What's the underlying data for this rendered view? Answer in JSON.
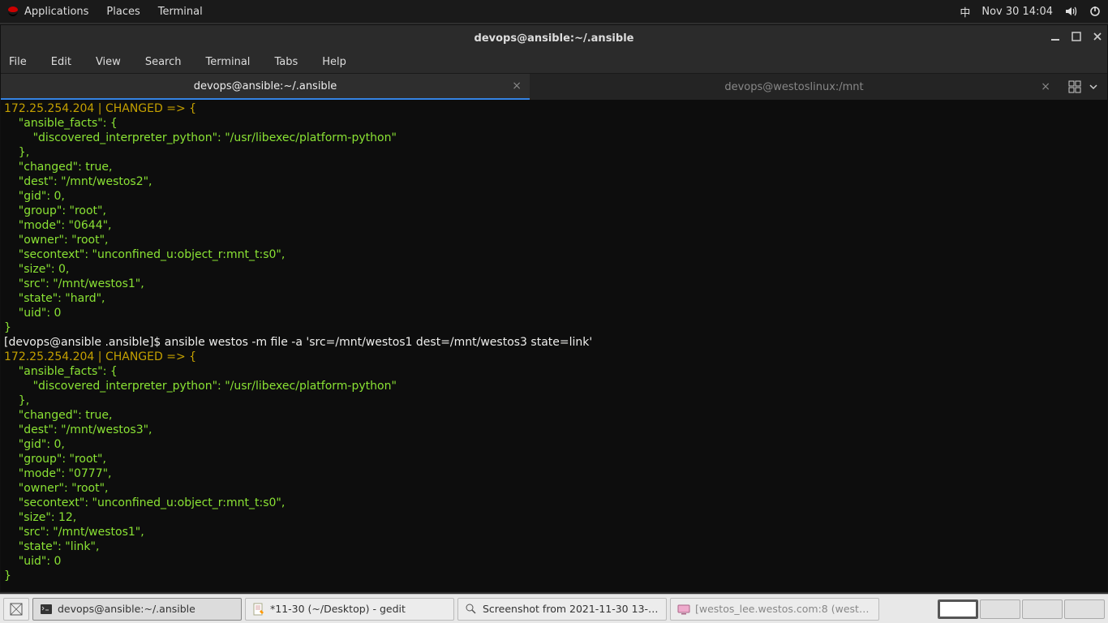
{
  "topbar": {
    "applications": "Applications",
    "places": "Places",
    "terminal": "Terminal",
    "ime": "中",
    "clock": "Nov 30  14:04"
  },
  "window": {
    "title": "devops@ansible:~/.ansible",
    "menu": {
      "file": "File",
      "edit": "Edit",
      "view": "View",
      "search": "Search",
      "terminal": "Terminal",
      "tabs": "Tabs",
      "help": "Help"
    },
    "tabs": [
      {
        "label": "devops@ansible:~/.ansible",
        "active": true
      },
      {
        "label": "devops@westoslinux:/mnt",
        "active": false
      }
    ]
  },
  "terminal": {
    "header1": "172.25.254.204 | CHANGED => {",
    "block1": "    \"ansible_facts\": {\n        \"discovered_interpreter_python\": \"/usr/libexec/platform-python\"\n    },\n    \"changed\": true,\n    \"dest\": \"/mnt/westos2\",\n    \"gid\": 0,\n    \"group\": \"root\",\n    \"mode\": \"0644\",\n    \"owner\": \"root\",\n    \"secontext\": \"unconfined_u:object_r:mnt_t:s0\",\n    \"size\": 0,\n    \"src\": \"/mnt/westos1\",\n    \"state\": \"hard\",\n    \"uid\": 0\n}",
    "prompt": "[devops@ansible .ansible]$ ",
    "command": "ansible westos -m file -a 'src=/mnt/westos1 dest=/mnt/westos3 state=link'",
    "header2": "172.25.254.204 | CHANGED => {",
    "block2": "    \"ansible_facts\": {\n        \"discovered_interpreter_python\": \"/usr/libexec/platform-python\"\n    },\n    \"changed\": true,\n    \"dest\": \"/mnt/westos3\",\n    \"gid\": 0,\n    \"group\": \"root\",\n    \"mode\": \"0777\",\n    \"owner\": \"root\",\n    \"secontext\": \"unconfined_u:object_r:mnt_t:s0\",\n    \"size\": 12,\n    \"src\": \"/mnt/westos1\",\n    \"state\": \"link\",\n    \"uid\": 0\n}"
  },
  "taskbar": {
    "items": [
      {
        "label": "devops@ansible:~/.ansible"
      },
      {
        "label": "*11-30 (~/Desktop) - gedit"
      },
      {
        "label": "Screenshot from 2021-11-30 13-4…"
      },
      {
        "label": "[westos_lee.westos.com:8 (westos)…"
      }
    ]
  }
}
